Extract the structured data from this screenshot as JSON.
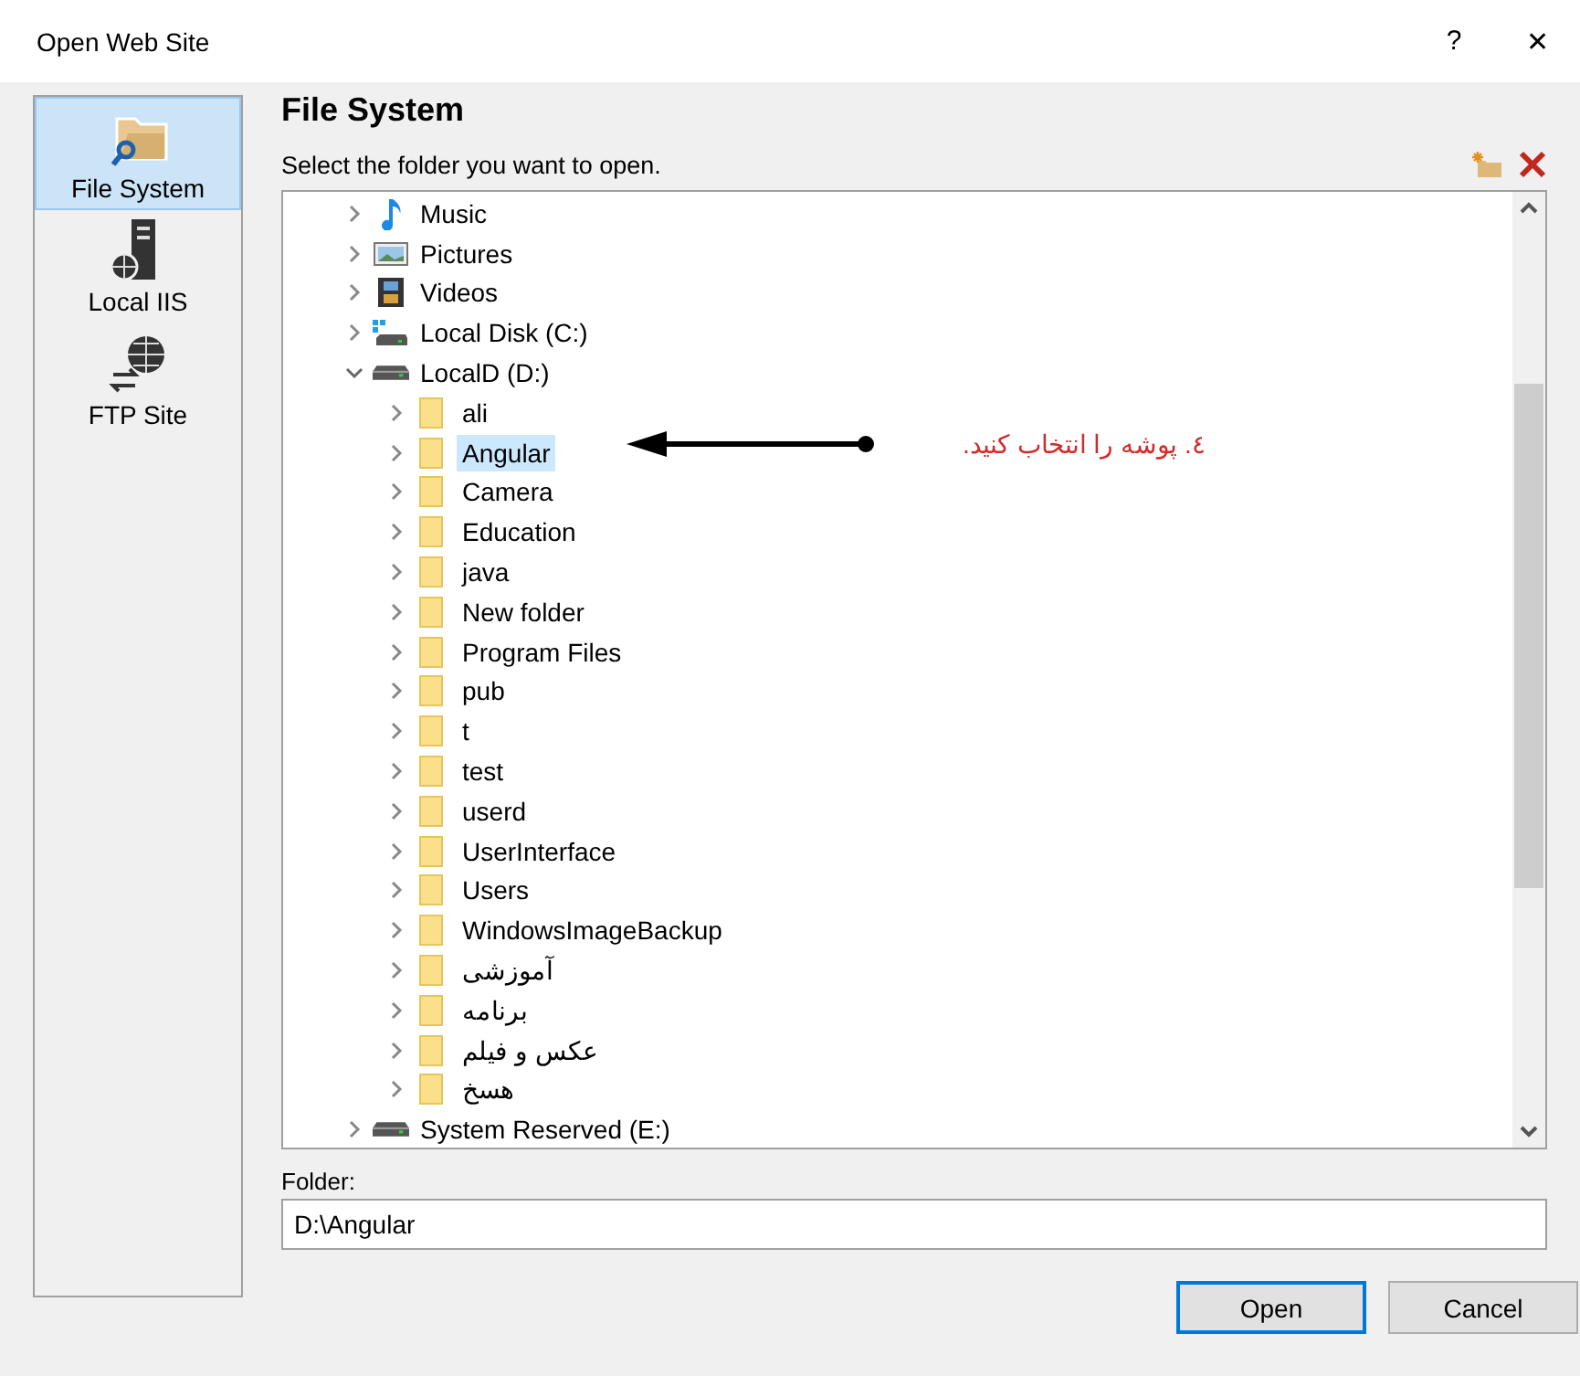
{
  "window": {
    "title": "Open Web Site",
    "help": "?",
    "close": "✕"
  },
  "sidebar": {
    "items": [
      {
        "label": "File System",
        "kind": "folder-search",
        "selected": true
      },
      {
        "label": "Local IIS",
        "kind": "server",
        "selected": false
      },
      {
        "label": "FTP Site",
        "kind": "globe",
        "selected": false
      }
    ]
  },
  "panel": {
    "title": "File System",
    "instruction": "Select the folder you want to open."
  },
  "tree": {
    "items": [
      {
        "label": "Music",
        "kind": "music",
        "expanded": false,
        "selected": false
      },
      {
        "label": "Pictures",
        "kind": "pictures",
        "expanded": false,
        "selected": false
      },
      {
        "label": "Videos",
        "kind": "videos",
        "expanded": false,
        "selected": false
      },
      {
        "label": "Local Disk (C:)",
        "kind": "system-drive",
        "expanded": false,
        "selected": false
      },
      {
        "label": "LocalD (D:)",
        "kind": "drive",
        "expanded": true,
        "selected": false,
        "children": [
          {
            "label": "ali",
            "expanded": false,
            "selected": false
          },
          {
            "label": "Angular",
            "expanded": false,
            "selected": true
          },
          {
            "label": "Camera",
            "expanded": false,
            "selected": false
          },
          {
            "label": "Education",
            "expanded": false,
            "selected": false
          },
          {
            "label": "java",
            "expanded": false,
            "selected": false
          },
          {
            "label": "New folder",
            "expanded": false,
            "selected": false
          },
          {
            "label": "Program Files",
            "expanded": false,
            "selected": false
          },
          {
            "label": "pub",
            "expanded": false,
            "selected": false
          },
          {
            "label": "t",
            "expanded": false,
            "selected": false
          },
          {
            "label": "test",
            "expanded": false,
            "selected": false
          },
          {
            "label": "userd",
            "expanded": false,
            "selected": false
          },
          {
            "label": "UserInterface",
            "expanded": false,
            "selected": false
          },
          {
            "label": "Users",
            "expanded": false,
            "selected": false
          },
          {
            "label": "WindowsImageBackup",
            "expanded": false,
            "selected": false
          },
          {
            "label": "آموزشی",
            "expanded": false,
            "selected": false
          },
          {
            "label": "برنامه",
            "expanded": false,
            "selected": false
          },
          {
            "label": "عکس و فیلم",
            "expanded": false,
            "selected": false
          },
          {
            "label": "هسخ",
            "expanded": false,
            "selected": false
          }
        ]
      },
      {
        "label": "System Reserved (E:)",
        "kind": "drive",
        "expanded": false,
        "selected": false
      }
    ]
  },
  "annotation": {
    "text": "٤. پوشه را انتخاب کنید."
  },
  "folder": {
    "label": "Folder:",
    "value": "D:\\Angular"
  },
  "buttons": [
    {
      "label": "Open",
      "default": true
    },
    {
      "label": "Cancel",
      "default": false
    }
  ]
}
